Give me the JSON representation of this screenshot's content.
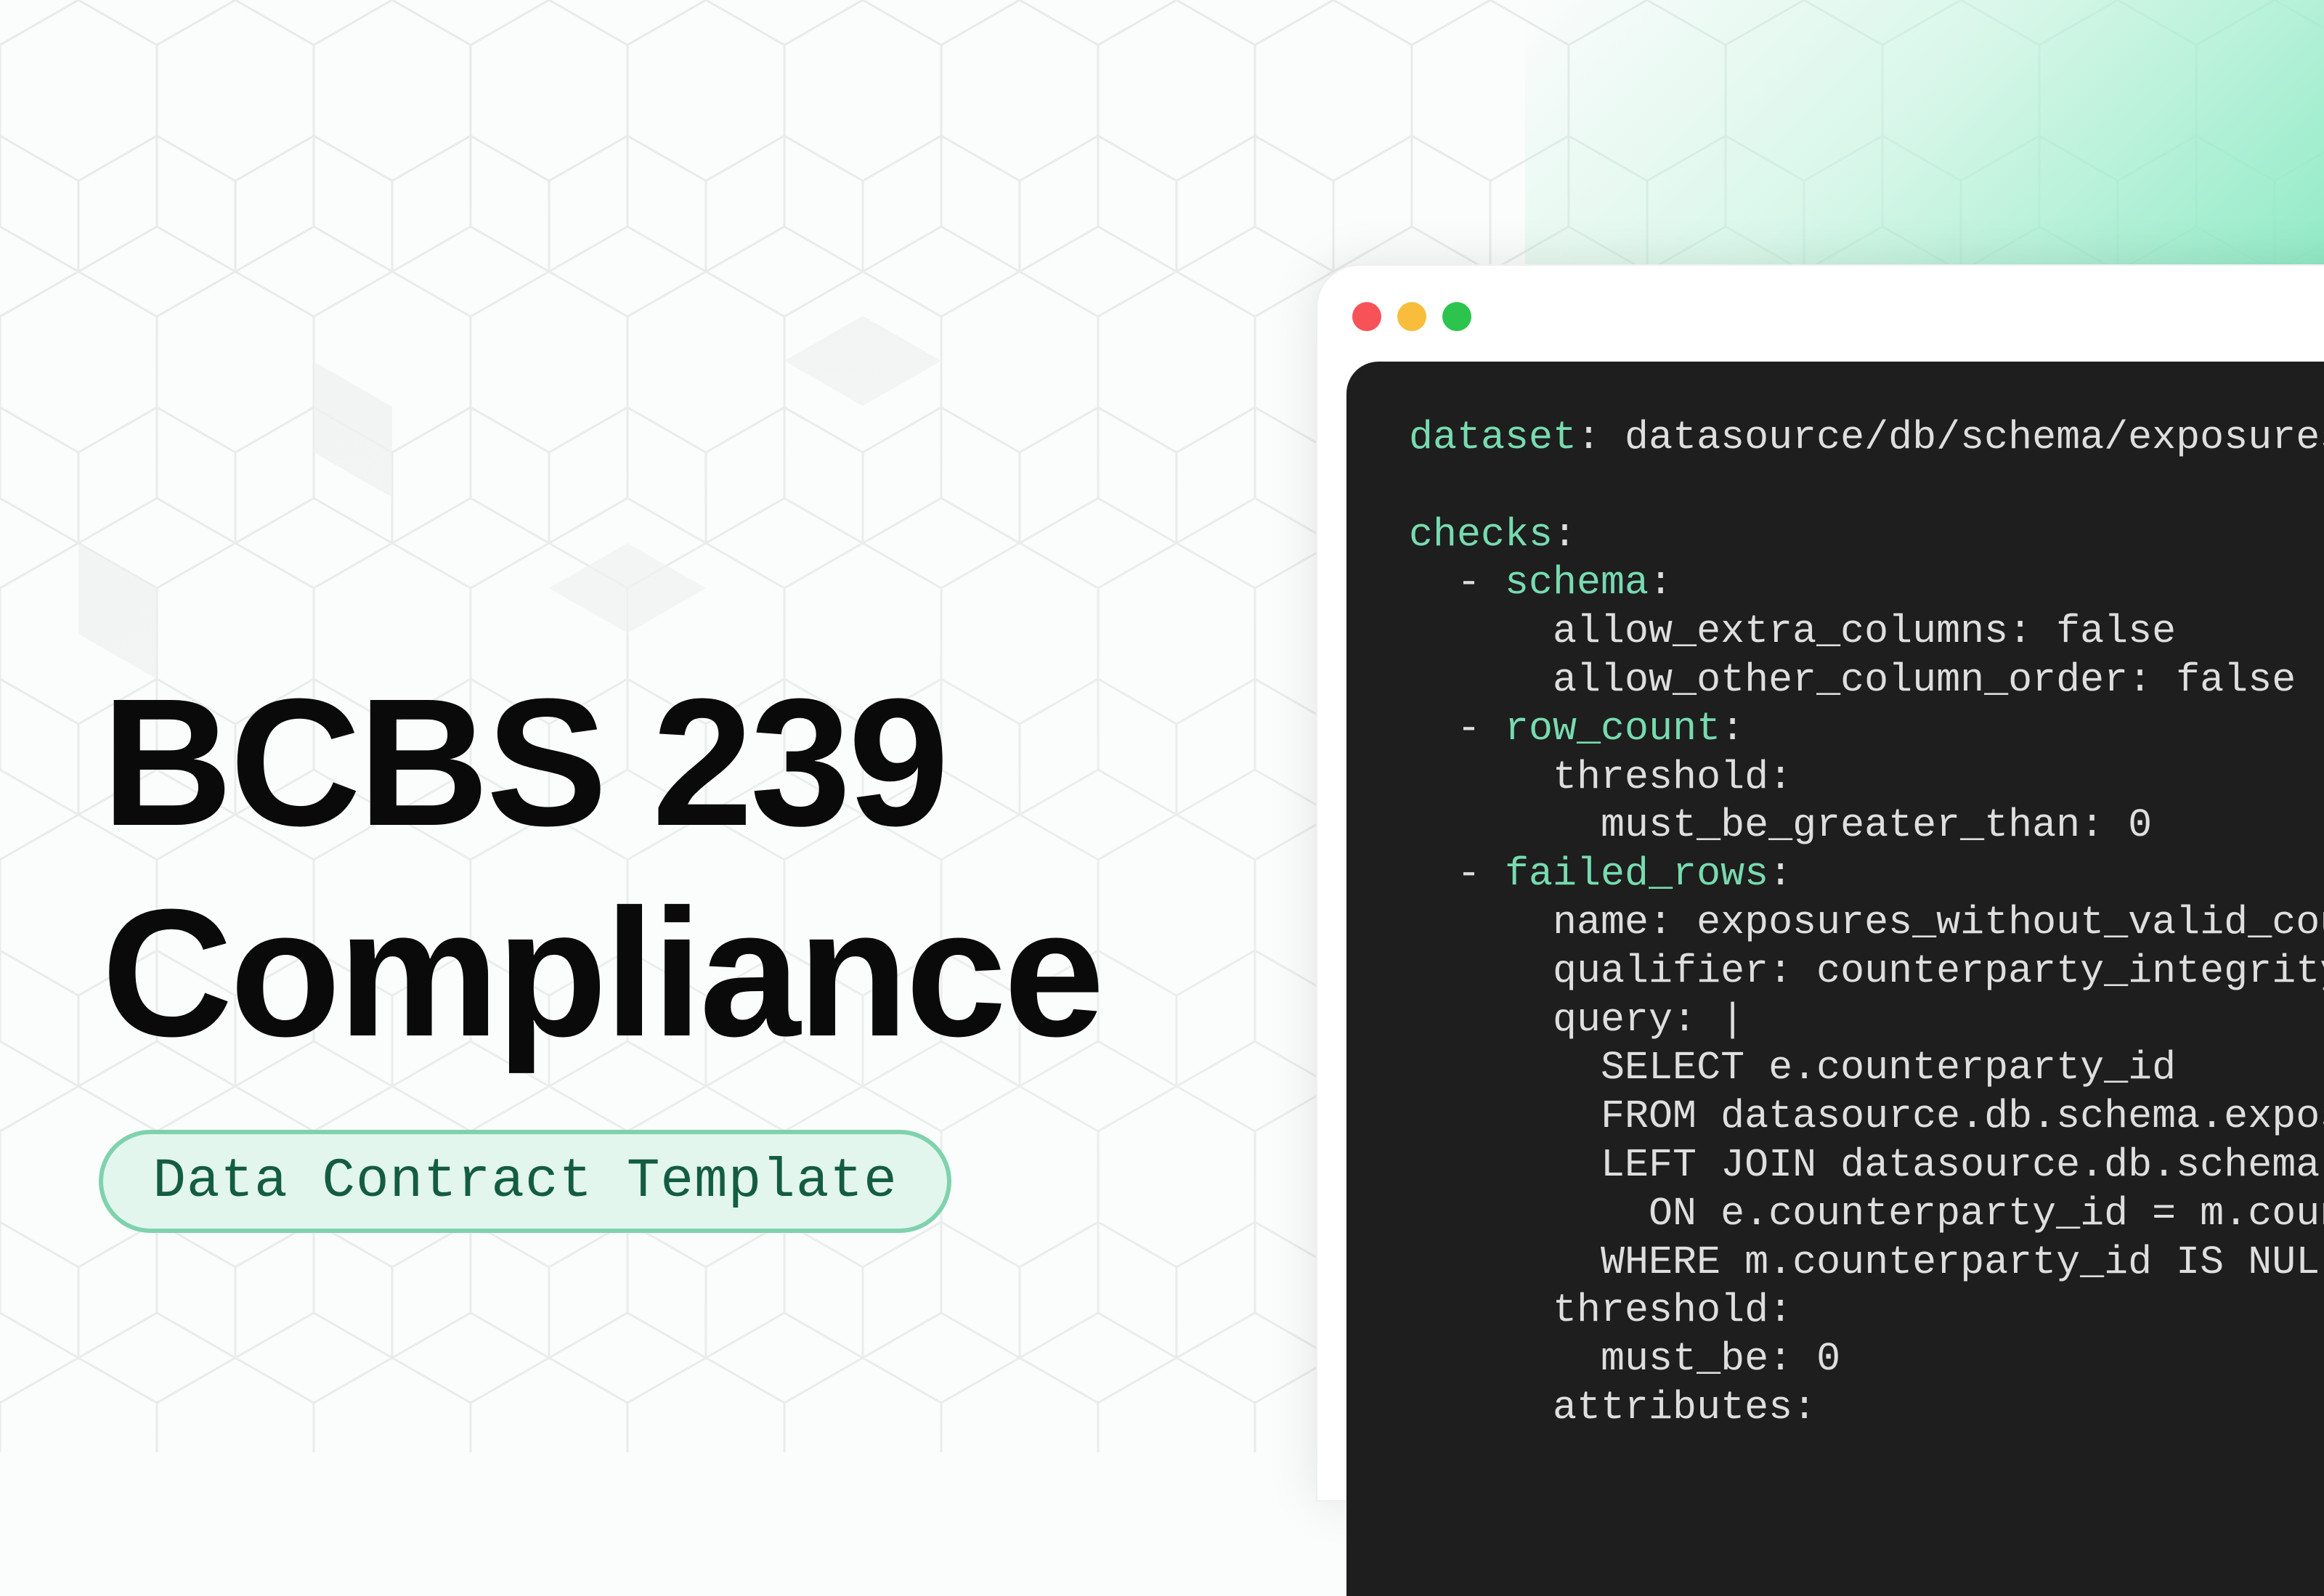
{
  "heading": {
    "line1": "BCBS 239",
    "line2": "Compliance"
  },
  "badge": {
    "label": "Data Contract Template"
  },
  "colors": {
    "accent": "#77dbb0",
    "badge_border": "#7fd2ad",
    "badge_fill": "#e2f6ed",
    "badge_text": "#145c44",
    "code_background": "#1e1e1e",
    "window_dot_red": "#f65258",
    "window_dot_yellow": "#f7bd3b",
    "window_dot_green": "#2dc44d"
  },
  "editor": {
    "window_controls": [
      "close-dot",
      "minimize-dot",
      "maximize-dot"
    ],
    "lines": [
      {
        "indent": "",
        "key": "dataset",
        "rest": ": datasource/db/schema/exposures"
      },
      {
        "indent": "",
        "key": "",
        "rest": ""
      },
      {
        "indent": "",
        "key": "checks",
        "rest": ":"
      },
      {
        "indent": "  - ",
        "key": "schema",
        "rest": ":"
      },
      {
        "indent": "",
        "key": "",
        "rest": "      allow_extra_columns: false"
      },
      {
        "indent": "",
        "key": "",
        "rest": "      allow_other_column_order: false"
      },
      {
        "indent": "  - ",
        "key": "row_count",
        "rest": ":"
      },
      {
        "indent": "",
        "key": "",
        "rest": "      threshold:"
      },
      {
        "indent": "",
        "key": "",
        "rest": "        must_be_greater_than: 0"
      },
      {
        "indent": "  - ",
        "key": "failed_rows",
        "rest": ":"
      },
      {
        "indent": "",
        "key": "",
        "rest": "      name: exposures_without_valid_cou"
      },
      {
        "indent": "",
        "key": "",
        "rest": "      qualifier: counterparty_integrity"
      },
      {
        "indent": "",
        "key": "",
        "rest": "      query: |"
      },
      {
        "indent": "",
        "key": "",
        "rest": "        SELECT e.counterparty_id"
      },
      {
        "indent": "",
        "key": "",
        "rest": "        FROM datasource.db.schema.expos"
      },
      {
        "indent": "",
        "key": "",
        "rest": "        LEFT JOIN datasource.db.schema."
      },
      {
        "indent": "",
        "key": "",
        "rest": "          ON e.counterparty_id = m.coun"
      },
      {
        "indent": "",
        "key": "",
        "rest": "        WHERE m.counterparty_id IS NULL"
      },
      {
        "indent": "",
        "key": "",
        "rest": "      threshold:"
      },
      {
        "indent": "",
        "key": "",
        "rest": "        must_be: 0"
      },
      {
        "indent": "",
        "key": "",
        "rest": "      attributes:"
      }
    ]
  }
}
